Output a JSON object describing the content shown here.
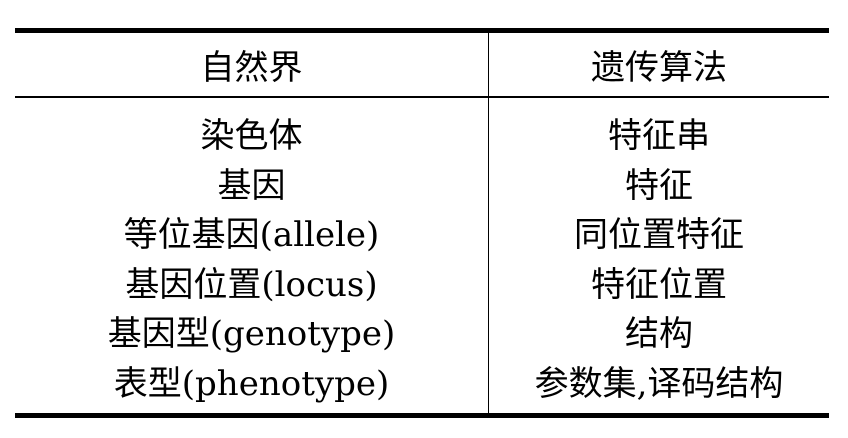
{
  "table": {
    "headers": {
      "nature": "自然界",
      "ga": "遗传算法"
    },
    "rows": [
      {
        "nature": "染色体",
        "ga": "特征串"
      },
      {
        "nature": "基因",
        "ga": "特征"
      },
      {
        "nature": "等位基因(allele)",
        "ga": "同位置特征"
      },
      {
        "nature": "基因位置(locus)",
        "ga": "特征位置"
      },
      {
        "nature": "基因型(genotype)",
        "ga": "结构"
      },
      {
        "nature": "表型(phenotype)",
        "ga": "参数集,译码结构"
      }
    ]
  }
}
